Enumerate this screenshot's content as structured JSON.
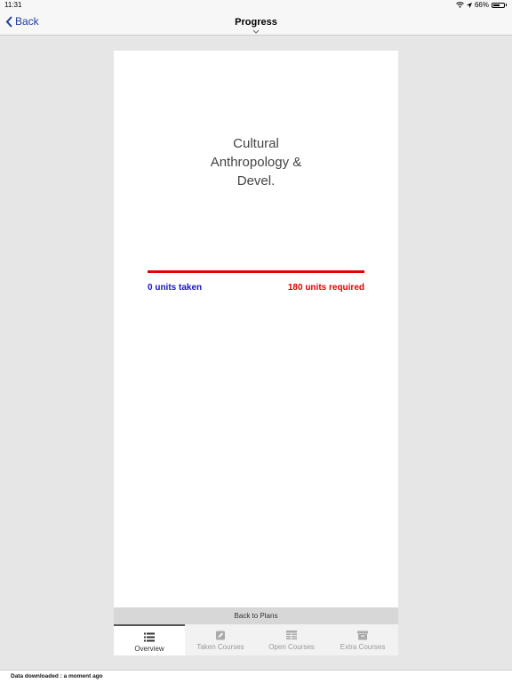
{
  "status_bar": {
    "time": "11:31",
    "battery": "66%",
    "battery_level": 0.66
  },
  "nav": {
    "back_label": "Back",
    "title": "Progress"
  },
  "plan": {
    "title_lines": [
      "Cultural",
      "Anthropology &",
      "Devel."
    ],
    "units_taken_label": "0 units taken",
    "units_required_label": "180 units required",
    "progress_fraction": 0,
    "colors": {
      "taken": "#1a14c8",
      "required": "#e30000"
    }
  },
  "back_to_plans_label": "Back to Plans",
  "tabs": [
    {
      "label": "Overview",
      "icon": "list-icon",
      "active": true
    },
    {
      "label": "Taken Courses",
      "icon": "edit-icon",
      "active": false
    },
    {
      "label": "Open Courses",
      "icon": "table-icon",
      "active": false
    },
    {
      "label": "Extra Courses",
      "icon": "archive-icon",
      "active": false
    }
  ],
  "footer_text": "Data downloaded : a moment ago"
}
